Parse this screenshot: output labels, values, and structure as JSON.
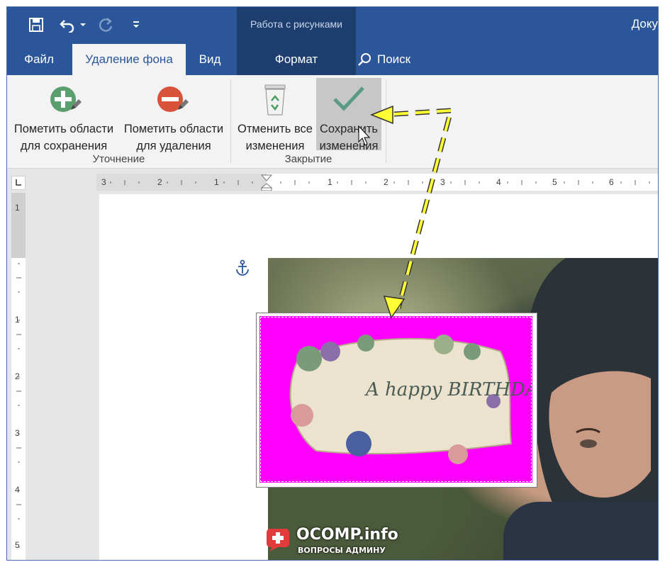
{
  "title_bar": {
    "context_group": "Работа с рисунками",
    "document_title": "Доку",
    "qat": {
      "save_icon": "save-icon",
      "undo_icon": "undo-icon",
      "redo_icon": "redo-icon",
      "customize_icon": "customize-qat-icon"
    }
  },
  "tabs": [
    {
      "label": "Файл"
    },
    {
      "label": "Удаление фона"
    },
    {
      "label": "Вид"
    },
    {
      "label": "Формат"
    }
  ],
  "search": {
    "label": "Поиск",
    "icon": "search-icon"
  },
  "ribbon": {
    "refine": {
      "label": "Уточнение",
      "mark_keep": {
        "line1": "Пометить области",
        "line2": "для сохранения",
        "icon": "plus-pencil-icon"
      },
      "mark_remove": {
        "line1": "Пометить области",
        "line2": "для удаления",
        "icon": "minus-pencil-icon"
      }
    },
    "close": {
      "label": "Закрытие",
      "discard": {
        "line1": "Отменить все",
        "line2": "изменения",
        "icon": "recycle-bin-icon"
      },
      "keep": {
        "line1": "Сохранить",
        "line2": "изменения",
        "icon": "checkmark-icon"
      }
    }
  },
  "ruler": {
    "horizontal": [
      "3",
      "2",
      "1",
      "1",
      "2",
      "3",
      "4",
      "5",
      "6"
    ],
    "vertical": [
      "1",
      "1",
      "2",
      "3",
      "4",
      "5"
    ]
  },
  "document": {
    "greeting_text": "A happy BIRTHDAY."
  },
  "watermark": {
    "brand": "OCOMP.info",
    "tagline": "ВОПРОСЫ АДМИНУ"
  },
  "colors": {
    "word_blue": "#2b579a",
    "context_blue": "#1e3e70",
    "removed_area": "#ff00ff",
    "arrow": "#ffff33"
  }
}
